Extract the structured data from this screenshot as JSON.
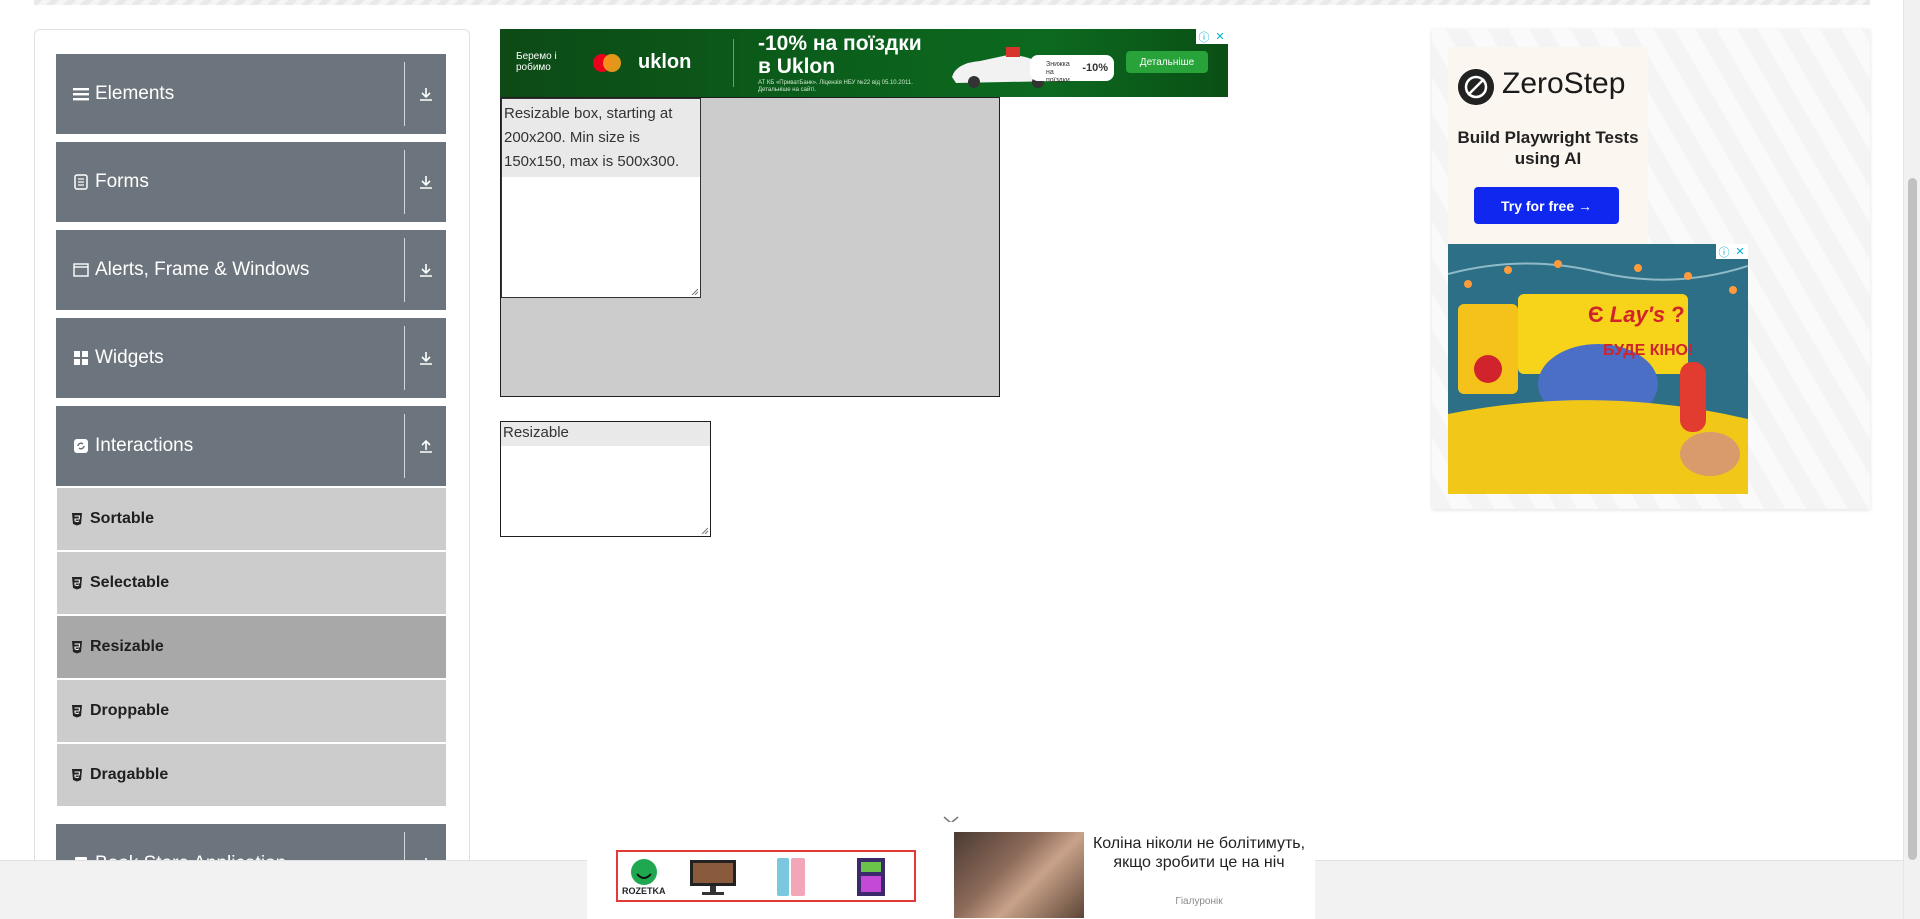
{
  "sidebar": {
    "groups": [
      {
        "label": "Elements",
        "icon": "hamburger-icon",
        "expanded": false
      },
      {
        "label": "Forms",
        "icon": "form-icon",
        "expanded": false
      },
      {
        "label": "Alerts, Frame & Windows",
        "icon": "window-icon",
        "expanded": false
      },
      {
        "label": "Widgets",
        "icon": "widgets-icon",
        "expanded": false
      },
      {
        "label": "Interactions",
        "icon": "interactions-icon",
        "expanded": true
      },
      {
        "label": "Book Store Application",
        "icon": "book-icon",
        "expanded": false
      }
    ],
    "interactions_items": [
      {
        "label": "Sortable",
        "active": false
      },
      {
        "label": "Selectable",
        "active": false
      },
      {
        "label": "Resizable",
        "active": true
      },
      {
        "label": "Droppable",
        "active": false
      },
      {
        "label": "Dragabble",
        "active": false
      }
    ]
  },
  "top_ad": {
    "brand": "Беремо і робимо",
    "logo": "uklon",
    "headline_line1": "-10% на поїздки",
    "headline_line2": "в Uklon",
    "fine_print": "АТ КБ «ПриватБанк». Ліцензія НБУ №22 від 05.10.2011. Детальніше на сайті.",
    "promo_text": "Знижка на поїздки",
    "promo_percent": "-10%",
    "cta": "Детальніше",
    "info_icon": "ⓘ",
    "close_icon": "✕"
  },
  "resizable": {
    "constrained_text": "Resizable box, starting at 200x200. Min size is 150x150, max is 500x300.",
    "free_label": "Resizable"
  },
  "right_ad": {
    "zerostep_name": "ZeroStep",
    "zerostep_tagline": "Build Playwright Tests using AI",
    "zerostep_cta": "Try for free →",
    "lays_text1": "Є",
    "lays_brand": "Lay's",
    "lays_text2": "?",
    "lays_text3": "БУДЕ КІНО!",
    "info_icon": "ⓘ",
    "close_icon": "✕"
  },
  "bottom_ad": {
    "rozetka_name": "ROZETKA",
    "news_title": "Коліна ніколи не болітимуть, якщо зробити це на ніч",
    "news_source": "Гіалуронік"
  },
  "colors": {
    "group_bg": "#6c757d",
    "sub_bg": "#cccccc",
    "sub_active_bg": "#a8a8a8",
    "uklon_green": "#0b5e1b",
    "zerostep_blue": "#1027f0",
    "rozetka_red": "#e53935"
  }
}
